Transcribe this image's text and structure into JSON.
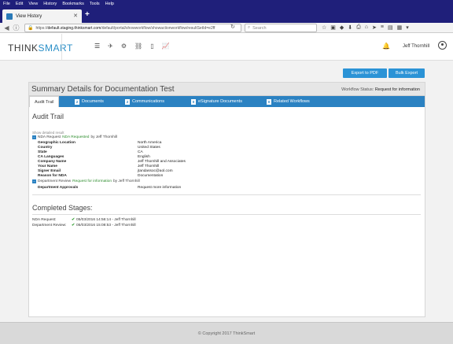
{
  "browser": {
    "menu": [
      "File",
      "Edit",
      "View",
      "History",
      "Bookmarks",
      "Tools",
      "Help"
    ],
    "tab_title": "View History",
    "new_tab": "+",
    "url_prefix": "https://",
    "url_host": "default.staging.thinksmart.com",
    "url_path": "/default/portal/showworkflow/showactionworkflow/resultSetId=e2ff",
    "search_placeholder": "Search"
  },
  "app": {
    "logo_left": "THINK",
    "logo_right": "SMART",
    "user_name": "Jeff Thornhill"
  },
  "actions": {
    "export_pdf": "Export to PDF",
    "bulk_export": "Bulk Export"
  },
  "panel": {
    "title": "Summary Details for Documentation Test",
    "workflow_status_label": "Workflow Status:",
    "workflow_status_value": "Request for information"
  },
  "tabs": [
    {
      "label": "Audit Trail",
      "badge": ""
    },
    {
      "label": "Documents",
      "badge": "2"
    },
    {
      "label": "Communications",
      "badge": "2"
    },
    {
      "label": "eSignature Documents",
      "badge": "0"
    },
    {
      "label": "Related Workflows",
      "badge": "0"
    }
  ],
  "audit": {
    "title": "Audit Trail",
    "show_hint": "Show detailed result",
    "event1": {
      "name": "NDA Request",
      "action": "NDA Requested",
      "by": "by Jeff Thornhill"
    },
    "details1": [
      {
        "label": "Geographic Location",
        "value": "North America"
      },
      {
        "label": "Country",
        "value": "United States"
      },
      {
        "label": "State",
        "value": "CA"
      },
      {
        "label": "CA Languages",
        "value": "English"
      },
      {
        "label": "Company Name",
        "value": "Jeff Thornhill and Associates"
      },
      {
        "label": "Your Name",
        "value": "Jeff Thornhill"
      },
      {
        "label": "Signer Email",
        "value": "jtandassoc@aol.com"
      },
      {
        "label": "Reason for NDA",
        "value": "Documentation"
      }
    ],
    "event2": {
      "name": "Department Review",
      "action": "Request for information",
      "by": "by Jeff Thornhill"
    },
    "details2": [
      {
        "label": "Department Approvals",
        "value": "Request more information"
      }
    ]
  },
  "completed": {
    "title": "Completed Stages:",
    "stages": [
      {
        "name": "NDA Request:",
        "datetime": "05/03/2016 14:56:14 - Jeff Thornhill"
      },
      {
        "name": "Department Review:",
        "datetime": "05/03/2016 15:08:53 - Jeff Thornhill"
      }
    ]
  },
  "footer": {
    "copyright": "© Copyright 2017 ThinkSmart"
  },
  "colors": {
    "accent": "#2b93d6",
    "tab_bar": "#2b82c2",
    "browser_chrome": "#1f1f7a"
  }
}
